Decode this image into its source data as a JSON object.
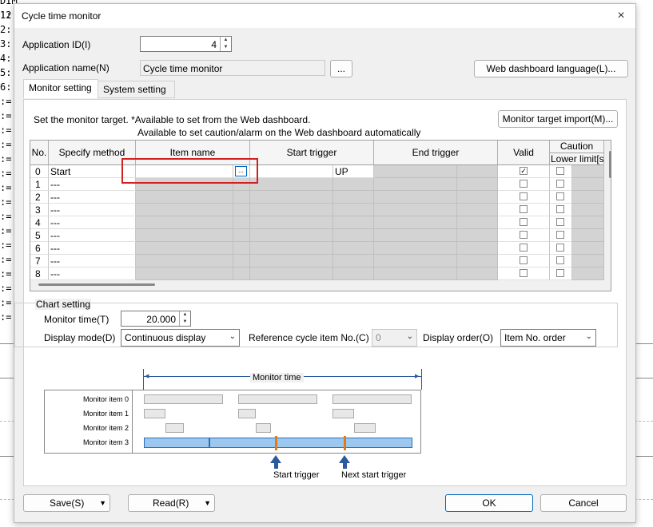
{
  "background": {
    "code_lines": [
      "DIM 12;",
      "1:",
      "2:",
      "3:",
      "4:",
      "5:",
      "6:",
      ":=",
      ":=",
      ":=",
      ":=",
      ":=",
      ":=",
      ":=",
      ":=",
      ":=",
      ":=",
      ":=",
      ":=",
      ":=",
      ":=",
      ":=",
      ":="
    ]
  },
  "dialog": {
    "title": "Cycle time monitor",
    "close_label": "×",
    "app_id_label": "Application ID(I)",
    "app_id_value": "4",
    "app_name_label": "Application name(N)",
    "app_name_value": "Cycle time monitor",
    "browse_label": "...",
    "web_lang_button": "Web dashboard language(L)...",
    "tabs": [
      {
        "label": "Monitor setting",
        "active": true
      },
      {
        "label": "System setting",
        "active": false
      }
    ],
    "monitor": {
      "instruction_line1": "Set the monitor target. *Available to set from the Web dashboard.",
      "instruction_line2": "Available to set caution/alarm on the Web dashboard automatically",
      "import_button": "Monitor target import(M)...",
      "columns": [
        "No.",
        "Specify method",
        "Item name",
        "Start trigger",
        "End trigger",
        "Valid",
        "Caution",
        "Lower limit[s]"
      ],
      "rows": [
        {
          "no": "0",
          "method": "Start",
          "start_trigger": "UP",
          "valid": true
        },
        {
          "no": "1",
          "method": "---",
          "start_trigger": "",
          "valid": false
        },
        {
          "no": "2",
          "method": "---",
          "start_trigger": "",
          "valid": false
        },
        {
          "no": "3",
          "method": "---",
          "start_trigger": "",
          "valid": false
        },
        {
          "no": "4",
          "method": "---",
          "start_trigger": "",
          "valid": false
        },
        {
          "no": "5",
          "method": "---",
          "start_trigger": "",
          "valid": false
        },
        {
          "no": "6",
          "method": "---",
          "start_trigger": "",
          "valid": false
        },
        {
          "no": "7",
          "method": "---",
          "start_trigger": "",
          "valid": false
        },
        {
          "no": "8",
          "method": "---",
          "start_trigger": "",
          "valid": false
        }
      ],
      "item_browse_label": "...",
      "check_mark": "✓"
    },
    "chart_setting": {
      "group_label": "Chart setting",
      "monitor_time_label": "Monitor time(T)",
      "monitor_time_value": "20.000",
      "display_mode_label": "Display mode(D)",
      "display_mode_value": "Continuous display",
      "ref_cycle_label": "Reference cycle item No.(C)",
      "ref_cycle_value": "0",
      "display_order_label": "Display order(O)",
      "display_order_value": "Item No. order"
    },
    "diagram": {
      "monitor_time_label": "Monitor time",
      "items": [
        "Monitor item 0",
        "Monitor item 1",
        "Monitor item 2",
        "Monitor item 3"
      ],
      "start_trigger_label": "Start trigger",
      "next_start_trigger_label": "Next start trigger"
    },
    "footer": {
      "save_label": "Save(S)",
      "read_label": "Read(R)",
      "ok_label": "OK",
      "cancel_label": "Cancel"
    }
  }
}
